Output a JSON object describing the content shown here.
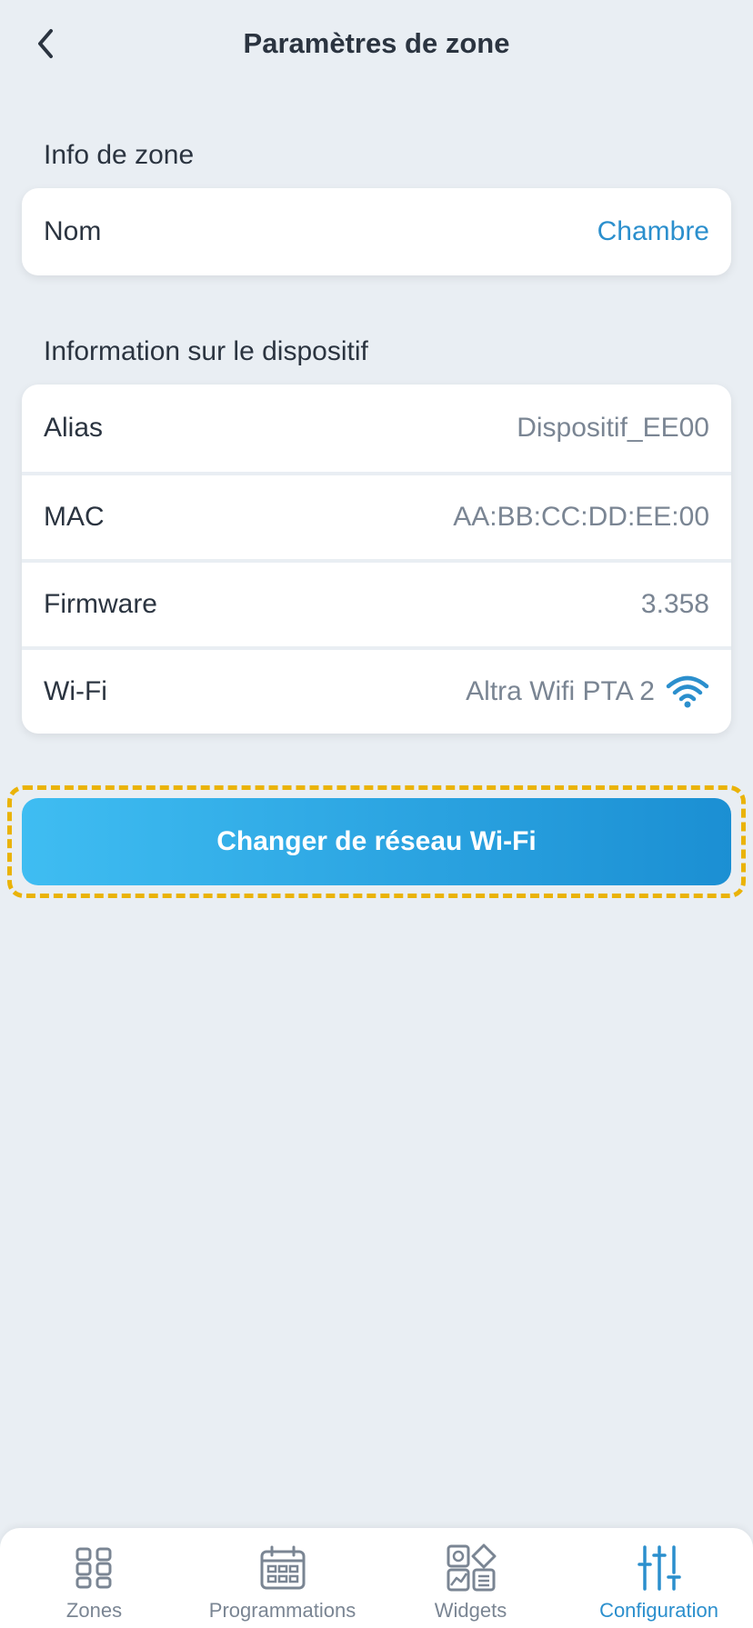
{
  "header": {
    "title": "Paramètres de zone"
  },
  "zone_info": {
    "section_title": "Info de zone",
    "name_label": "Nom",
    "name_value": "Chambre"
  },
  "device_info": {
    "section_title": "Information sur le dispositif",
    "rows": [
      {
        "label": "Alias",
        "value": "Dispositif_EE00"
      },
      {
        "label": "MAC",
        "value": "AA:BB:CC:DD:EE:00"
      },
      {
        "label": "Firmware",
        "value": "3.358"
      },
      {
        "label": "Wi-Fi",
        "value": "Altra Wifi PTA 2",
        "icon": "wifi-icon"
      }
    ]
  },
  "actions": {
    "change_wifi_label": "Changer de réseau Wi-Fi"
  },
  "tabbar": {
    "items": [
      {
        "label": "Zones",
        "icon": "grid-icon"
      },
      {
        "label": "Programmations",
        "icon": "calendar-icon"
      },
      {
        "label": "Widgets",
        "icon": "widgets-icon"
      },
      {
        "label": "Configuration",
        "icon": "sliders-icon",
        "active": true
      }
    ]
  },
  "colors": {
    "background": "#e9eef3",
    "accent": "#2b8fcd",
    "button_gradient_start": "#3fbdf2",
    "button_gradient_end": "#1b8fd3",
    "highlight_border": "#eab308"
  }
}
